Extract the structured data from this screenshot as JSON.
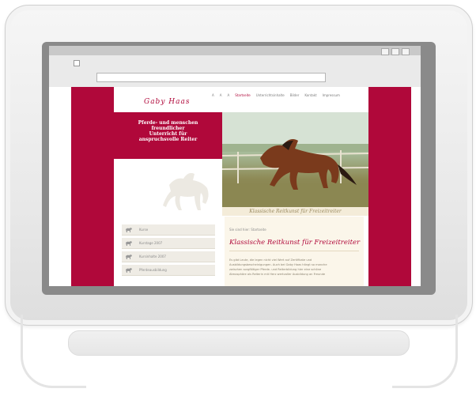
{
  "website": {
    "logo": "Gaby Haas",
    "nav": [
      "A",
      "A",
      "A",
      "Startseite",
      "Unterrichtsinhalte",
      "Bilder",
      "Kontakt",
      "Impressum"
    ],
    "nav_active_index": 3,
    "tagline_lines": [
      "Pferde- und menschen",
      "freundlicher",
      "Unterricht für",
      "anspruchsvolle Reiter"
    ],
    "banner_caption": "Klassische Reitkunst für Freizeitreiter",
    "menu": [
      {
        "label": "Kurse",
        "icon": "horse-icon"
      },
      {
        "label": "Kurstage 2007",
        "icon": "horse-icon"
      },
      {
        "label": "Kursinhalte 2007",
        "icon": "horse-icon"
      },
      {
        "label": "Pferdeausbildung",
        "icon": "horse-icon"
      }
    ],
    "breadcrumb": "Sie sind hier: Startseite",
    "heading": "Klassische Reitkunst für Freizeitreiter",
    "body_lines": [
      "Es gibt Leute, die legen nicht viel Wert auf Zertifikate und",
      "Ausbildungsbescheinigungen. Auch bei Gaby Haas hängt so manche",
      "zwischen sorgfältiger Pferde- und Reiterbildung hier eine schöne",
      "Atmosphäre als Reiterin mit Herz wertvoller Ausbildung an Freunde"
    ]
  },
  "colors": {
    "brand": "#b0083a",
    "bezel": "#ececec",
    "content_bg": "#fbf6ea"
  }
}
